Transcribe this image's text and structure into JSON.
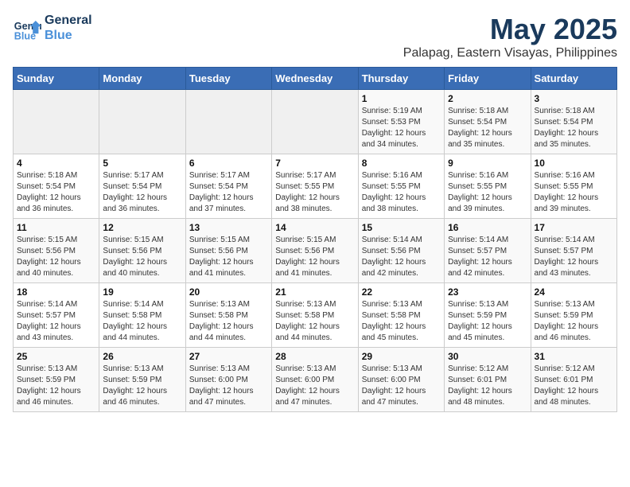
{
  "header": {
    "logo_line1": "General",
    "logo_line2": "Blue",
    "title": "May 2025",
    "subtitle": "Palapag, Eastern Visayas, Philippines"
  },
  "weekdays": [
    "Sunday",
    "Monday",
    "Tuesday",
    "Wednesday",
    "Thursday",
    "Friday",
    "Saturday"
  ],
  "weeks": [
    [
      {
        "day": "",
        "info": ""
      },
      {
        "day": "",
        "info": ""
      },
      {
        "day": "",
        "info": ""
      },
      {
        "day": "",
        "info": ""
      },
      {
        "day": "1",
        "info": "Sunrise: 5:19 AM\nSunset: 5:53 PM\nDaylight: 12 hours\nand 34 minutes."
      },
      {
        "day": "2",
        "info": "Sunrise: 5:18 AM\nSunset: 5:54 PM\nDaylight: 12 hours\nand 35 minutes."
      },
      {
        "day": "3",
        "info": "Sunrise: 5:18 AM\nSunset: 5:54 PM\nDaylight: 12 hours\nand 35 minutes."
      }
    ],
    [
      {
        "day": "4",
        "info": "Sunrise: 5:18 AM\nSunset: 5:54 PM\nDaylight: 12 hours\nand 36 minutes."
      },
      {
        "day": "5",
        "info": "Sunrise: 5:17 AM\nSunset: 5:54 PM\nDaylight: 12 hours\nand 36 minutes."
      },
      {
        "day": "6",
        "info": "Sunrise: 5:17 AM\nSunset: 5:54 PM\nDaylight: 12 hours\nand 37 minutes."
      },
      {
        "day": "7",
        "info": "Sunrise: 5:17 AM\nSunset: 5:55 PM\nDaylight: 12 hours\nand 38 minutes."
      },
      {
        "day": "8",
        "info": "Sunrise: 5:16 AM\nSunset: 5:55 PM\nDaylight: 12 hours\nand 38 minutes."
      },
      {
        "day": "9",
        "info": "Sunrise: 5:16 AM\nSunset: 5:55 PM\nDaylight: 12 hours\nand 39 minutes."
      },
      {
        "day": "10",
        "info": "Sunrise: 5:16 AM\nSunset: 5:55 PM\nDaylight: 12 hours\nand 39 minutes."
      }
    ],
    [
      {
        "day": "11",
        "info": "Sunrise: 5:15 AM\nSunset: 5:56 PM\nDaylight: 12 hours\nand 40 minutes."
      },
      {
        "day": "12",
        "info": "Sunrise: 5:15 AM\nSunset: 5:56 PM\nDaylight: 12 hours\nand 40 minutes."
      },
      {
        "day": "13",
        "info": "Sunrise: 5:15 AM\nSunset: 5:56 PM\nDaylight: 12 hours\nand 41 minutes."
      },
      {
        "day": "14",
        "info": "Sunrise: 5:15 AM\nSunset: 5:56 PM\nDaylight: 12 hours\nand 41 minutes."
      },
      {
        "day": "15",
        "info": "Sunrise: 5:14 AM\nSunset: 5:56 PM\nDaylight: 12 hours\nand 42 minutes."
      },
      {
        "day": "16",
        "info": "Sunrise: 5:14 AM\nSunset: 5:57 PM\nDaylight: 12 hours\nand 42 minutes."
      },
      {
        "day": "17",
        "info": "Sunrise: 5:14 AM\nSunset: 5:57 PM\nDaylight: 12 hours\nand 43 minutes."
      }
    ],
    [
      {
        "day": "18",
        "info": "Sunrise: 5:14 AM\nSunset: 5:57 PM\nDaylight: 12 hours\nand 43 minutes."
      },
      {
        "day": "19",
        "info": "Sunrise: 5:14 AM\nSunset: 5:58 PM\nDaylight: 12 hours\nand 44 minutes."
      },
      {
        "day": "20",
        "info": "Sunrise: 5:13 AM\nSunset: 5:58 PM\nDaylight: 12 hours\nand 44 minutes."
      },
      {
        "day": "21",
        "info": "Sunrise: 5:13 AM\nSunset: 5:58 PM\nDaylight: 12 hours\nand 44 minutes."
      },
      {
        "day": "22",
        "info": "Sunrise: 5:13 AM\nSunset: 5:58 PM\nDaylight: 12 hours\nand 45 minutes."
      },
      {
        "day": "23",
        "info": "Sunrise: 5:13 AM\nSunset: 5:59 PM\nDaylight: 12 hours\nand 45 minutes."
      },
      {
        "day": "24",
        "info": "Sunrise: 5:13 AM\nSunset: 5:59 PM\nDaylight: 12 hours\nand 46 minutes."
      }
    ],
    [
      {
        "day": "25",
        "info": "Sunrise: 5:13 AM\nSunset: 5:59 PM\nDaylight: 12 hours\nand 46 minutes."
      },
      {
        "day": "26",
        "info": "Sunrise: 5:13 AM\nSunset: 5:59 PM\nDaylight: 12 hours\nand 46 minutes."
      },
      {
        "day": "27",
        "info": "Sunrise: 5:13 AM\nSunset: 6:00 PM\nDaylight: 12 hours\nand 47 minutes."
      },
      {
        "day": "28",
        "info": "Sunrise: 5:13 AM\nSunset: 6:00 PM\nDaylight: 12 hours\nand 47 minutes."
      },
      {
        "day": "29",
        "info": "Sunrise: 5:13 AM\nSunset: 6:00 PM\nDaylight: 12 hours\nand 47 minutes."
      },
      {
        "day": "30",
        "info": "Sunrise: 5:12 AM\nSunset: 6:01 PM\nDaylight: 12 hours\nand 48 minutes."
      },
      {
        "day": "31",
        "info": "Sunrise: 5:12 AM\nSunset: 6:01 PM\nDaylight: 12 hours\nand 48 minutes."
      }
    ]
  ]
}
